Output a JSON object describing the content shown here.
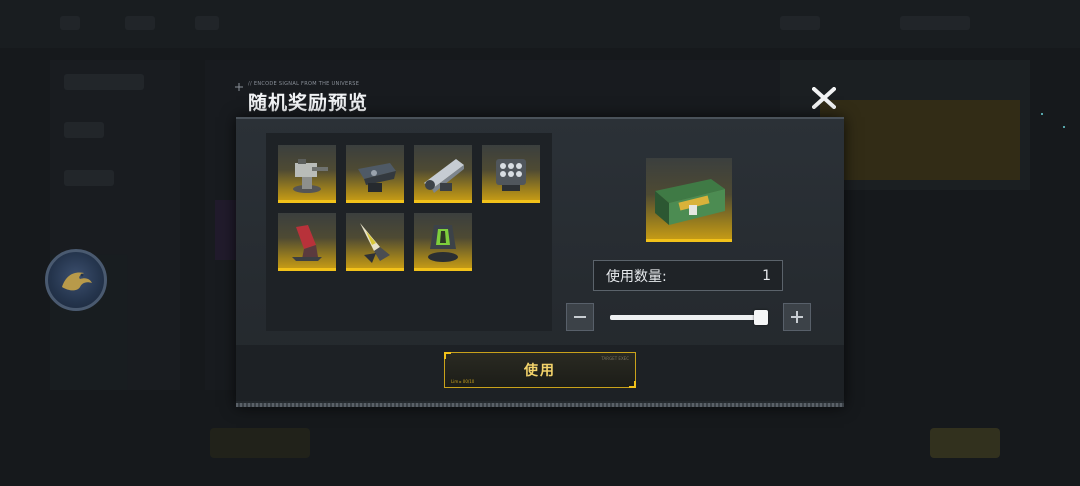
{
  "dialog": {
    "title": "随机奖励预览",
    "subtitle": "// ENCODE SIGNAL FROM THE UNIVERSE",
    "close_icon": "close-x-icon"
  },
  "rewards": [
    {
      "name": "turret-cannon-icon"
    },
    {
      "name": "heavy-artillery-icon"
    },
    {
      "name": "railgun-icon"
    },
    {
      "name": "missile-launcher-icon"
    },
    {
      "name": "red-crystal-module-icon"
    },
    {
      "name": "blade-drone-icon"
    },
    {
      "name": "green-core-module-icon"
    }
  ],
  "chest": {
    "icon": "supply-chest-icon"
  },
  "quantity": {
    "label": "使用数量:",
    "value": "1",
    "slider_fraction": 1.0
  },
  "buttons": {
    "minus": "−",
    "plus": "+",
    "use_label": "使用",
    "use_tiny_left": "Lim ▸ 00/10",
    "use_tiny_right": "TARGET   EXEC"
  },
  "colors": {
    "accent_gold": "#f2c21a",
    "panel_dark": "#1e2226",
    "modal_bg": "#2b3137"
  }
}
